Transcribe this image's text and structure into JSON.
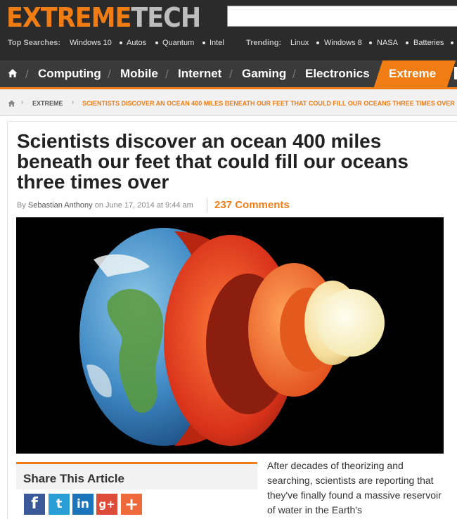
{
  "logo": {
    "part1": "EXTREME",
    "part2": "TECH"
  },
  "top_searches": {
    "label": "Top Searches:",
    "items": [
      "Windows 10",
      "Autos",
      "Quantum",
      "Intel"
    ]
  },
  "trending": {
    "label": "Trending:",
    "items": [
      "Linux",
      "Windows 8",
      "NASA",
      "Batteries"
    ]
  },
  "nav": {
    "items": [
      "Computing",
      "Mobile",
      "Internet",
      "Gaming",
      "Electronics"
    ],
    "active": "Extreme"
  },
  "breadcrumb": {
    "section": "EXTREME",
    "current": "SCIENTISTS DISCOVER AN OCEAN 400 MILES BENEATH OUR FEET THAT COULD FILL OUR OCEANS THREE TIMES OVER"
  },
  "article": {
    "title": "Scientists discover an ocean 400 miles beneath our feet that could fill our oceans three times over",
    "by": "By",
    "author": "Sebastian Anthony",
    "on": "on",
    "date": "June 17, 2014 at 9:44 am",
    "comments": "237 Comments",
    "intro": "After decades of theorizing and searching, scientists are reporting that they've finally found a massive reservoir of water in the Earth's"
  },
  "share": {
    "title": "Share This Article",
    "buttons": [
      {
        "name": "facebook",
        "glyph": "f"
      },
      {
        "name": "twitter",
        "glyph": "t"
      },
      {
        "name": "linkedin",
        "glyph": "in"
      },
      {
        "name": "google-plus",
        "glyph": "g+"
      },
      {
        "name": "more",
        "glyph": "+"
      }
    ]
  },
  "colors": {
    "accent": "#f07c14",
    "header_bg": "#2b2b2b",
    "nav_bg": "#3a3a3a"
  }
}
